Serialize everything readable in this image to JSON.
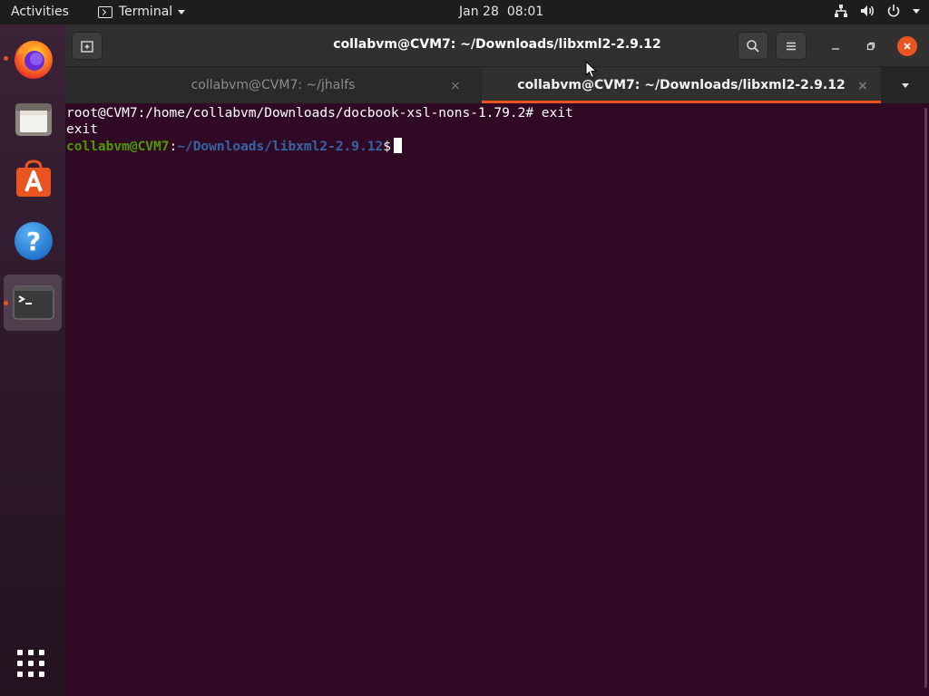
{
  "topbar": {
    "activities_label": "Activities",
    "app_menu_label": "Terminal",
    "date": "Jan 28",
    "time": "08:01"
  },
  "dock": {
    "items": [
      {
        "name": "Firefox",
        "icon": "firefox-icon",
        "running": true
      },
      {
        "name": "Files",
        "icon": "files-icon",
        "running": false
      },
      {
        "name": "Ubuntu Software",
        "icon": "software-store-icon",
        "running": false
      },
      {
        "name": "Help",
        "icon": "help-icon",
        "running": false
      },
      {
        "name": "Terminal",
        "icon": "terminal-icon",
        "running": true,
        "active": true
      }
    ],
    "show_apps_icon": "app-grid-icon"
  },
  "window": {
    "title": "collabvm@CVM7: ~/Downloads/libxml2-2.9.12",
    "tabs": [
      {
        "label": "collabvm@CVM7: ~/jhalfs",
        "active": false
      },
      {
        "label": "collabvm@CVM7: ~/Downloads/libxml2-2.9.12",
        "active": true
      }
    ],
    "tab_close_glyph": "×"
  },
  "terminal": {
    "lines": [
      "root@CVM7:/home/collabvm/Downloads/docbook-xsl-nons-1.79.2# exit",
      "exit"
    ],
    "prompt_user": "collabvm@CVM7",
    "prompt_sep": ":",
    "prompt_path": "~/Downloads/libxml2-2.9.12",
    "prompt_symbol": "$"
  },
  "colors": {
    "terminal_bg": "#300a24",
    "accent": "#e95420",
    "prompt_user": "#4e9a06",
    "prompt_path": "#3465a4"
  }
}
